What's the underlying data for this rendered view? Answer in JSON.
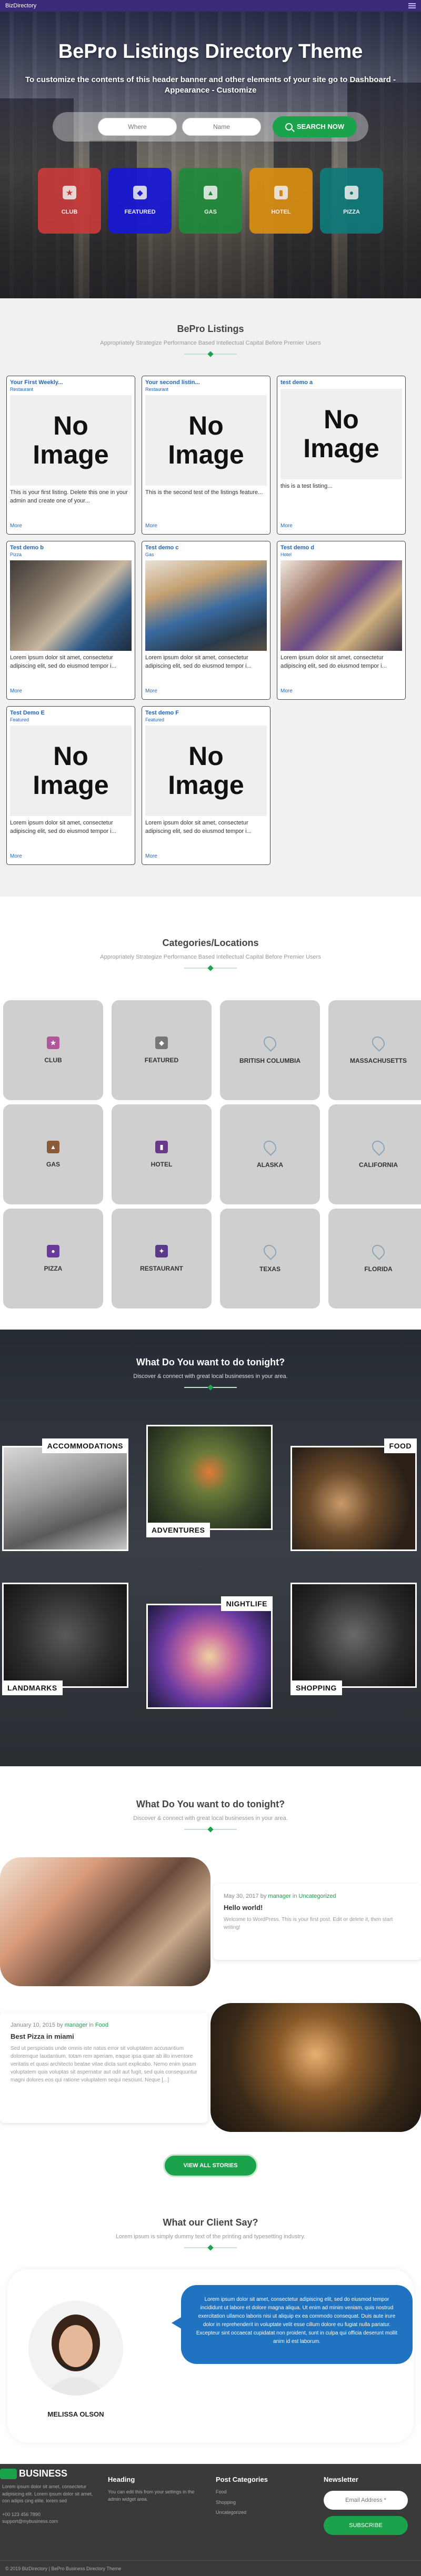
{
  "topbar": {
    "brand": "BizDirectory"
  },
  "hero": {
    "title": "BePro Listings Directory Theme",
    "subtitle": "To customize the contents of this header banner and other elements of your site go to Dashboard - Appearance - Customize",
    "where_placeholder": "Where",
    "name_placeholder": "Name",
    "search_label": "SEARCH NOW",
    "categories": [
      {
        "label": "CLUB",
        "color": "#d23a3a"
      },
      {
        "label": "FEATURED",
        "color": "#1515d0"
      },
      {
        "label": "GAS",
        "color": "#1f8a3a"
      },
      {
        "label": "HOTEL",
        "color": "#d68d10"
      },
      {
        "label": "PIZZA",
        "color": "#0f7a7a"
      }
    ]
  },
  "listings": {
    "title": "BePro Listings",
    "subtitle": "Appropriately Strategize Performance Based Intellectual Capital Before Premier Users",
    "items": [
      {
        "title": "Your First Weekly...",
        "cat": "Restaurant",
        "img": "No Image",
        "desc": "This is your first listing. Delete this one in your admin and create one of your...",
        "more": "More"
      },
      {
        "title": "Your second listin...",
        "cat": "Restaurant",
        "img": "No Image",
        "desc": "This is the second test of the listings feature...",
        "more": "More"
      },
      {
        "title": "test demo a",
        "cat": "",
        "img": "No Image",
        "desc": "this is a test listing...",
        "more": "More"
      },
      {
        "title": "Test demo b",
        "cat": "Pizza",
        "img": "",
        "desc": "Lorem ipsum dolor sit amet, consectetur adipiscing elit, sed do eiusmod tempor i...",
        "more": "More"
      },
      {
        "title": "Test demo c",
        "cat": "Gas",
        "img": "",
        "desc": "Lorem ipsum dolor sit amet, consectetur adipiscing elit, sed do eiusmod tempor i...",
        "more": "More"
      },
      {
        "title": "Test demo d",
        "cat": "Hotel",
        "img": "",
        "desc": "Lorem ipsum dolor sit amet, consectetur adipiscing elit, sed do eiusmod tempor i...",
        "more": "More"
      },
      {
        "title": "Test Demo E",
        "cat": "Featured",
        "img": "No Image",
        "desc": "Lorem ipsum dolor sit amet, consectetur adipiscing elit, sed do eiusmod tempor i...",
        "more": "More"
      },
      {
        "title": "Test demo F",
        "cat": "Featured",
        "img": "No Image",
        "desc": "Lorem ipsum dolor sit amet, consectetur adipiscing elit, sed do eiusmod tempor i...",
        "more": "More"
      }
    ]
  },
  "categories": {
    "title": "Categories/Locations",
    "subtitle": "Appropriately Strategize Performance Based Intellectual Capital Before Premier Users",
    "items": [
      {
        "label": "CLUB",
        "type": "cat",
        "color": "#b0569a"
      },
      {
        "label": "FEATURED",
        "type": "cat",
        "color": "#777777"
      },
      {
        "label": "BRITISH COLUMBIA",
        "type": "loc"
      },
      {
        "label": "MASSACHUSETTS",
        "type": "loc"
      },
      {
        "label": "GAS",
        "type": "cat",
        "color": "#8a5a3a"
      },
      {
        "label": "HOTEL",
        "type": "cat",
        "color": "#6a3a8a"
      },
      {
        "label": "ALASKA",
        "type": "loc"
      },
      {
        "label": "CALIFORNIA",
        "type": "loc"
      },
      {
        "label": "PIZZA",
        "type": "cat",
        "color": "#6a3a9a"
      },
      {
        "label": "RESTAURANT",
        "type": "cat",
        "color": "#5a3a8a"
      },
      {
        "label": "TEXAS",
        "type": "loc"
      },
      {
        "label": "FLORIDA",
        "type": "loc"
      }
    ]
  },
  "todo": {
    "title": "What Do You want to do tonight?",
    "subtitle": "Discover & connect with great local businesses in your area.",
    "tiles": [
      "ACCOMMODATIONS",
      "ADVENTURES",
      "FOOD",
      "LANDMARKS",
      "NIGHTLIFE",
      "SHOPPING"
    ]
  },
  "blog": {
    "title": "What Do You want to do tonight?",
    "subtitle": "Discover & connect with great local businesses in your area.",
    "posts": [
      {
        "date": "May 30, 2017 by",
        "author": "manager",
        "cat": "Uncategorized",
        "title": "Hello world!",
        "excerpt": "Welcome to WordPress. This is your first post. Edit or delete it, then start writing!"
      },
      {
        "date": "January 10, 2015 by",
        "author": "manager",
        "cat": "Food",
        "title": "Best Pizza in miami",
        "excerpt": "Sed ut perspiciatis unde omnis iste natus error sit voluptatem accusantium doloremque laudantium, totam rem aperiam, eaque ipsa quae ab illo inventore veritatis et quasi architecto beatae vitae dicta sunt explicabo. Nemo enim ipsam voluptatem quia voluptas sit aspernatur aut odit aut fugit, sed quia consequuntur magni dolores eos qui ratione voluptatem sequi nesciunt. Neque [...]"
      }
    ],
    "all_label": "VIEW ALL STORIES"
  },
  "testimonial": {
    "title": "What our Client Say?",
    "subtitle": "Lorem ipsum is simply dummy text of the printing and typesetting industry.",
    "quote": "Lorem ipsum dolor sit amet, consectetur adipiscing elit, sed do eiusmod tempor incididunt ut labore et dolore magna aliqua. Ut enim ad minim veniam, quis nostrud exercitation ullamco laboris nisi ut aliquip ex ea commodo consequat. Duis aute irure dolor in reprehenderit in voluptate velit esse cillum dolore eu fugiat nulla pariatur. Excepteur sint occaecat cupidatat non proident, sunt in culpa qui officia deserunt mollit anim id est laborum.",
    "name": "MELISSA OLSON"
  },
  "footer": {
    "brand": "BUSINESS",
    "about": "Lorem ipsum dolor sit amet, consectetur adipisicing elit. Lorem ipsum dolor sit amet, con adipis cing elite. lorem sed",
    "phone": "+00 123 456 7890",
    "email": "support@mybusiness.com",
    "heading_title": "Heading",
    "heading_text": "You can edit this from your settings in the admin widget area.",
    "postcat_title": "Post Categories",
    "postcats": [
      "Food",
      "Shopping",
      "Uncategorized"
    ],
    "newsletter_title": "Newsletter",
    "newsletter_placeholder": "Email Address *",
    "subscribe_label": "SUBSCRIBE",
    "copyright": "© 2019 BizDirectory | BePro Business Directory Theme"
  }
}
